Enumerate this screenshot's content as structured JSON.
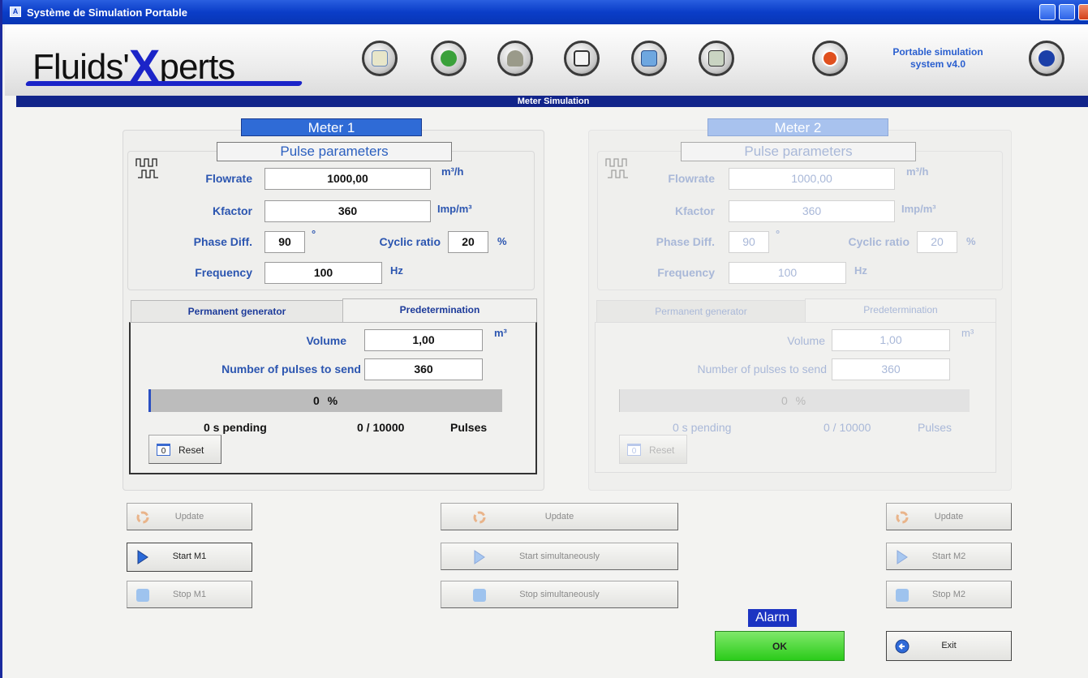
{
  "window": {
    "title": "Système de Simulation Portable"
  },
  "header": {
    "logo_pre": "Fluids'",
    "logo_x": "X",
    "logo_post": "perts",
    "version": "Portable simulation\nsystem v4.0"
  },
  "section": {
    "title": "Meter Simulation"
  },
  "meter1": {
    "title": "Meter 1",
    "sub": "Pulse parameters",
    "flowrate_label": "Flowrate",
    "flowrate": "1000,00",
    "flowrate_unit": "m³/h",
    "kfactor_label": "Kfactor",
    "kfactor": "360",
    "kfactor_unit": "Imp/m³",
    "phase_label": "Phase Diff.",
    "phase": "90",
    "phase_unit": "°",
    "cyclic_label": "Cyclic ratio",
    "cyclic": "20",
    "cyclic_unit": "%",
    "freq_label": "Frequency",
    "freq": "100",
    "freq_unit": "Hz",
    "tab1": "Permanent generator",
    "tab2": "Predetermination",
    "volume_label": "Volume",
    "volume": "1,00",
    "volume_unit": "m³",
    "pulses_label": "Number of pulses to send",
    "pulses": "360",
    "progress_text": "0 %",
    "progress": 0,
    "pending": "0 s pending",
    "count": "0 / 10000",
    "pulses_word": "Pulses",
    "reset_counter": "0",
    "reset": "Reset"
  },
  "meter2": {
    "title": "Meter 2",
    "sub": "Pulse parameters",
    "flowrate_label": "Flowrate",
    "flowrate": "1000,00",
    "flowrate_unit": "m³/h",
    "kfactor_label": "Kfactor",
    "kfactor": "360",
    "kfactor_unit": "Imp/m³",
    "phase_label": "Phase Diff.",
    "phase": "90",
    "phase_unit": "°",
    "cyclic_label": "Cyclic ratio",
    "cyclic": "20",
    "cyclic_unit": "%",
    "freq_label": "Frequency",
    "freq": "100",
    "freq_unit": "Hz",
    "tab1": "Permanent generator",
    "tab2": "Predetermination",
    "volume_label": "Volume",
    "volume": "1,00",
    "volume_unit": "m³",
    "pulses_label": "Number of pulses to send",
    "pulses": "360",
    "progress_text": "0 %",
    "progress": 0,
    "pending": "0 s pending",
    "count": "0 / 10000",
    "pulses_word": "Pulses",
    "reset_counter": "0",
    "reset": "Reset"
  },
  "buttons": {
    "update": "Update",
    "start_m1": "Start M1",
    "stop_m1": "Stop M1",
    "start_sim": "Start simultaneously",
    "stop_sim": "Stop simultaneously",
    "start_m2": "Start M2",
    "stop_m2": "Stop M2",
    "alarm": "Alarm",
    "ok": "OK",
    "exit": "Exit"
  },
  "colors": {
    "accent": "#1b24c8",
    "title_bar": "#0a3dc8",
    "ok_green": "#3bd52a"
  }
}
